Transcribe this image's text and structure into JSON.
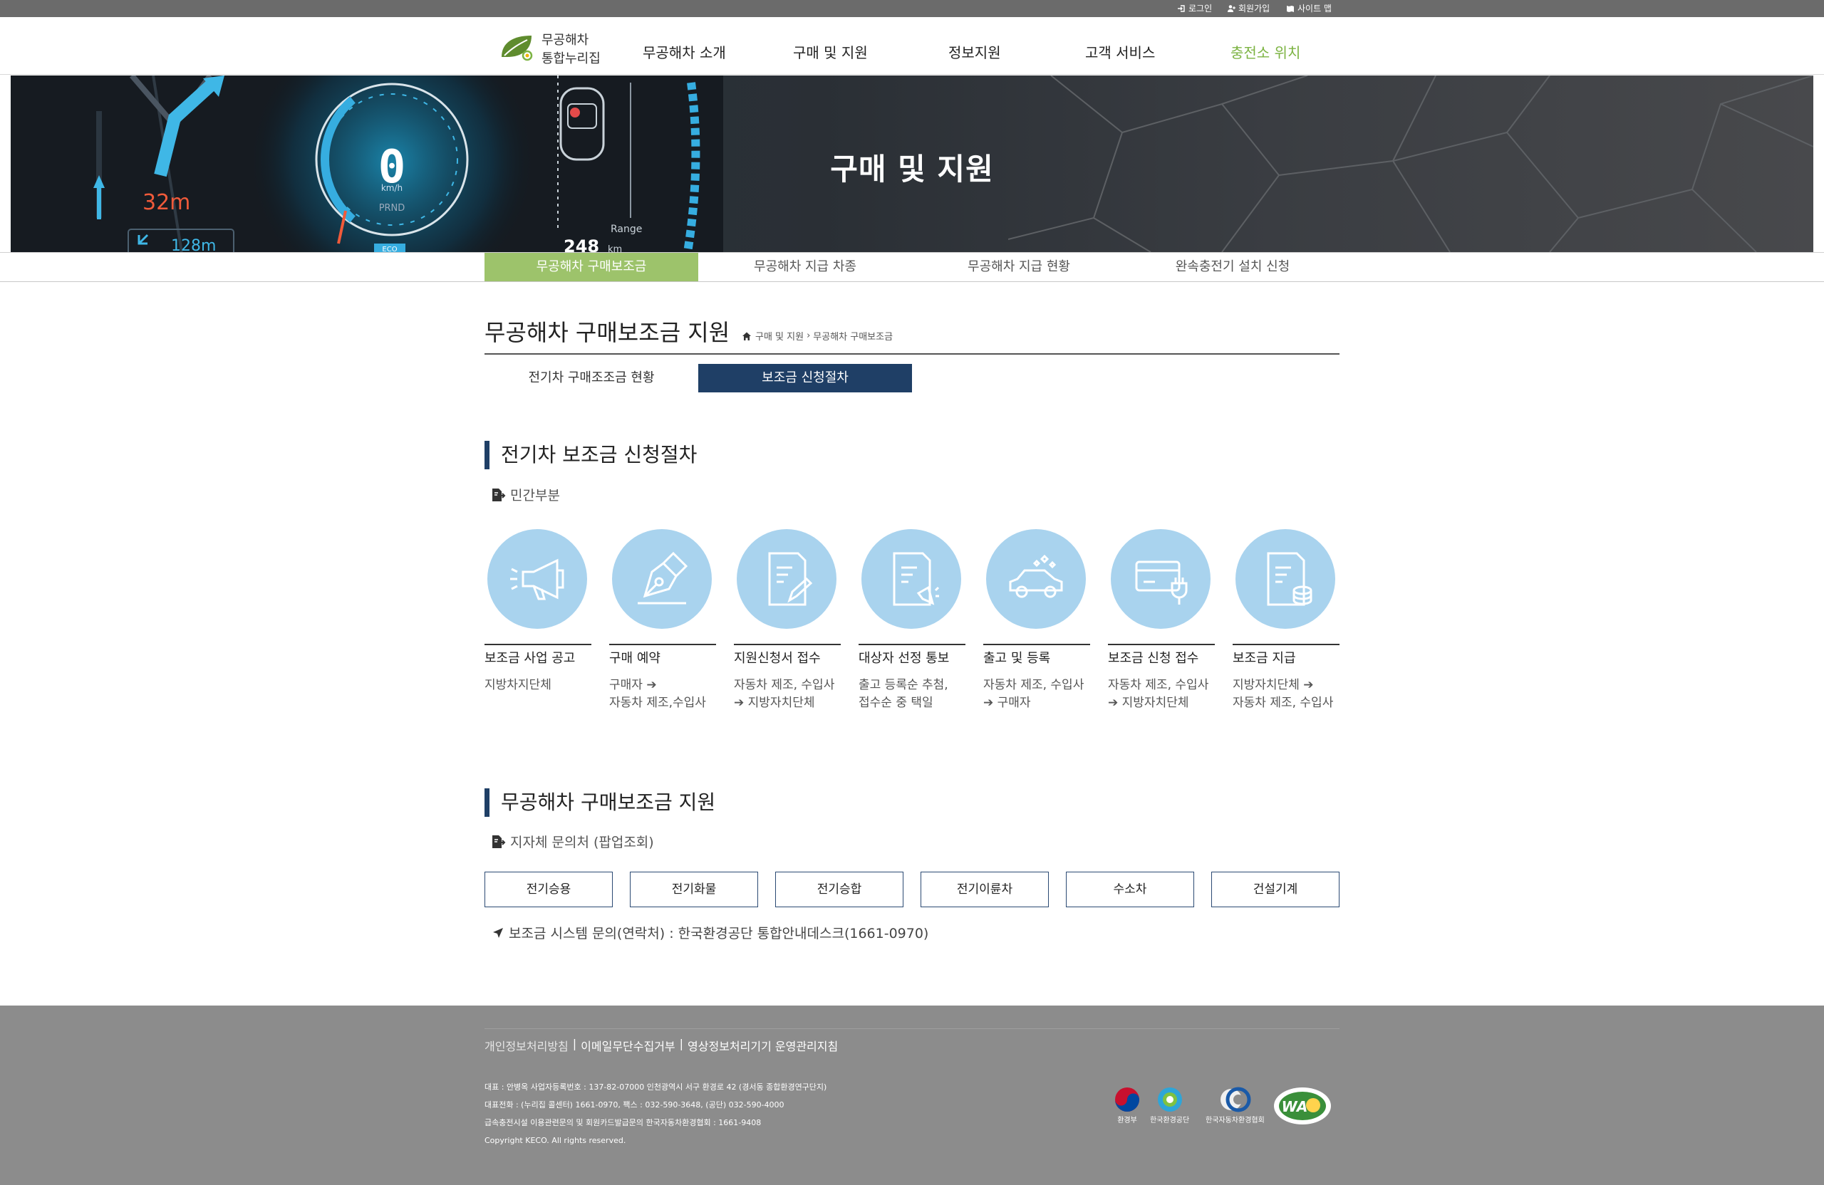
{
  "topbar": {
    "login": "로그인",
    "signup": "회원가입",
    "sitemap": "사이트 맵"
  },
  "header": {
    "logo_line1": "무공해차",
    "logo_line2": "통합누리집",
    "nav": [
      "무공해차 소개",
      "구매 및 지원",
      "정보지원",
      "고객 서비스",
      "충전소 위치"
    ],
    "active_color": "#7cb342"
  },
  "hero": {
    "title": "구매 및 지원",
    "dash_distance": "32m",
    "dash_next": "128m",
    "dash_speed": "0",
    "dash_unit": "km/h",
    "dash_gear": "PRND",
    "dash_range_label": "Range",
    "dash_range": "248",
    "dash_range_unit": "km",
    "dash_mode": "ECO"
  },
  "subnav": [
    "무공해차 구매보조금",
    "무공해차 지급 차종",
    "무공해차 지급 현황",
    "완속충전기 설치 신청"
  ],
  "page": {
    "title": "무공해차 구매보조금 지원",
    "breadcrumb": [
      "구매 및 지원",
      "무공해차 구매보조금"
    ],
    "tabs": [
      "전기차 구매조조금 현황",
      "보조금 신청절차"
    ],
    "accent": "#1f3f66"
  },
  "process": {
    "title": "전기차 보조금 신청절차",
    "label": "민간부분",
    "steps": [
      {
        "icon": "megaphone-icon",
        "title": "보조금 사업 공고",
        "desc1": "지방차지단체",
        "desc2": ""
      },
      {
        "icon": "pen-nib-icon",
        "title": "구매 예약",
        "desc1": "구매자 ➔",
        "desc2": "자동차 제조,수입사"
      },
      {
        "icon": "document-pen-icon",
        "title": "지원신청서 접수",
        "desc1": "자동차 제조, 수입사",
        "desc2": "➔ 지방자치단체"
      },
      {
        "icon": "document-megaphone-icon",
        "title": "대상자 선정 통보",
        "desc1": "출고 등록순 추첨,",
        "desc2": "접수순 중 택일"
      },
      {
        "icon": "car-sparkle-icon",
        "title": "출고 및 등록",
        "desc1": "자동차 제조, 수입사",
        "desc2": "➔ 구매자"
      },
      {
        "icon": "card-plug-icon",
        "title": "보조금 신청 접수",
        "desc1": "자동차 제조, 수입사",
        "desc2": "➔ 지방자치단체"
      },
      {
        "icon": "document-coins-icon",
        "title": "보조금 지급",
        "desc1": "지방자치단체 ➔",
        "desc2": "자동차 제조, 수입사"
      }
    ],
    "circle_color": "#a9d3ee"
  },
  "support": {
    "title": "무공해차 구매보조금 지원",
    "label": "지자체 문의처 (팝업조회)",
    "buttons": [
      "전기승용",
      "전기화물",
      "전기승합",
      "전기이륜차",
      "수소차",
      "건설기계"
    ],
    "contact": "보조금 시스템 문의(연락처) : 한국환경공단 통합안내데스크(1661-0970)"
  },
  "footer": {
    "links": [
      "개인정보처리방침",
      "이메일무단수집거부",
      "영상정보처리기기 운영관리지침"
    ],
    "info": [
      "대표 : 안병옥 사업자등록번호 : 137-82-07000 인천광역시 서구 환경로 42 (경서동 종합환경연구단지)",
      "대표전화 : (누리집 콜센터) 1661-0970, 팩스 : 032-590-3648, (공단) 032-590-4000",
      "급속충전시설 이용관련문의 및 회원카드발급문의 한국자동차환경협회 : 1661-9408",
      "Copyright KECO. All rights reserved."
    ],
    "logos": [
      "환경부",
      "한국환경공단",
      "한국자동차환경협회"
    ],
    "wa_mark": "WA"
  }
}
